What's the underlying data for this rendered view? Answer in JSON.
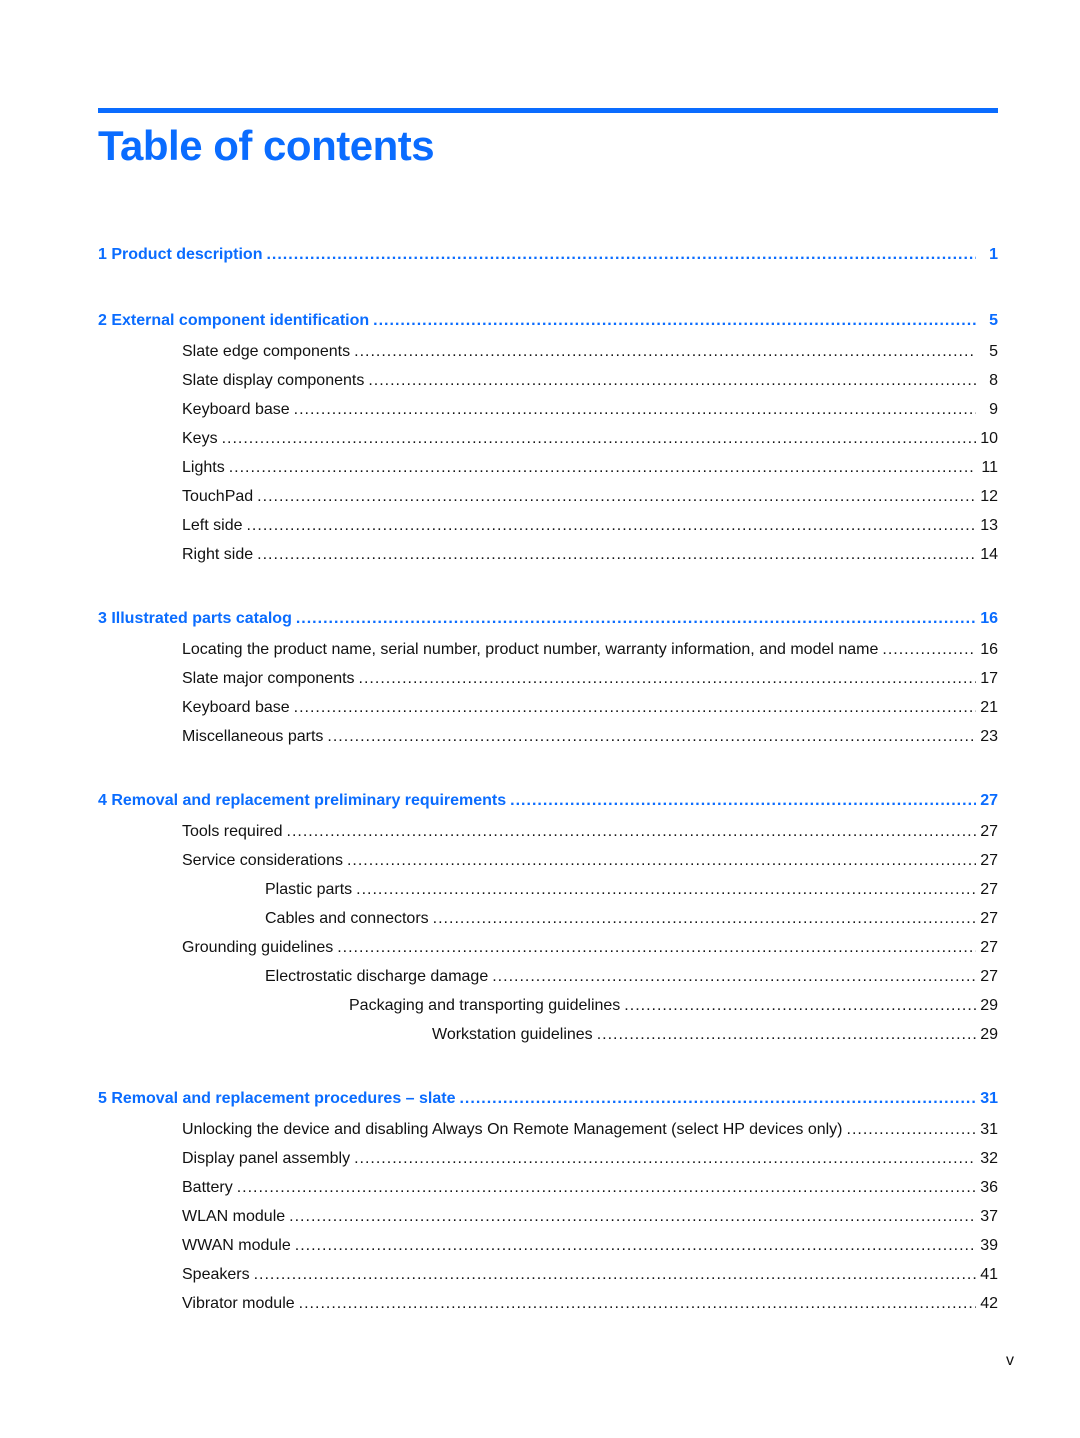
{
  "title": "Table of contents",
  "accent_color": "#0a6cff",
  "entries": [
    {
      "level": 0,
      "text": "1  Product description",
      "page": "1"
    },
    {
      "level": 0,
      "text": "2  External component identification",
      "page": "5"
    },
    {
      "level": 1,
      "text": "Slate edge components",
      "page": "5"
    },
    {
      "level": 1,
      "text": "Slate display components",
      "page": "8"
    },
    {
      "level": 1,
      "text": "Keyboard base",
      "page": "9"
    },
    {
      "level": 1,
      "text": "Keys",
      "page": "10"
    },
    {
      "level": 1,
      "text": "Lights",
      "page": "11"
    },
    {
      "level": 1,
      "text": "TouchPad",
      "page": "12"
    },
    {
      "level": 1,
      "text": "Left side",
      "page": "13"
    },
    {
      "level": 1,
      "text": "Right side",
      "page": "14"
    },
    {
      "level": 0,
      "text": "3  Illustrated parts catalog",
      "page": "16"
    },
    {
      "level": 1,
      "text": "Locating the product name, serial number, product number, warranty information, and model name",
      "page": "16"
    },
    {
      "level": 1,
      "text": "Slate major components",
      "page": "17"
    },
    {
      "level": 1,
      "text": "Keyboard base",
      "page": "21"
    },
    {
      "level": 1,
      "text": "Miscellaneous parts",
      "page": "23"
    },
    {
      "level": 0,
      "text": "4  Removal and replacement preliminary requirements",
      "page": "27"
    },
    {
      "level": 1,
      "text": "Tools required",
      "page": "27"
    },
    {
      "level": 1,
      "text": "Service considerations",
      "page": "27"
    },
    {
      "level": 2,
      "text": "Plastic parts",
      "page": "27"
    },
    {
      "level": 2,
      "text": "Cables and connectors",
      "page": "27"
    },
    {
      "level": 1,
      "text": "Grounding guidelines",
      "page": "27"
    },
    {
      "level": 2,
      "text": "Electrostatic discharge damage",
      "page": "27"
    },
    {
      "level": 3,
      "text": "Packaging and transporting guidelines",
      "page": "29"
    },
    {
      "level": 4,
      "text": "Workstation guidelines",
      "page": "29"
    },
    {
      "level": 0,
      "text": "5  Removal and replacement procedures – slate",
      "page": "31"
    },
    {
      "level": 1,
      "text": "Unlocking the device and disabling Always On Remote Management (select HP devices only)",
      "page": "31"
    },
    {
      "level": 1,
      "text": "Display panel assembly",
      "page": "32"
    },
    {
      "level": 1,
      "text": "Battery",
      "page": "36"
    },
    {
      "level": 1,
      "text": "WLAN module",
      "page": "37"
    },
    {
      "level": 1,
      "text": "WWAN module",
      "page": "39"
    },
    {
      "level": 1,
      "text": "Speakers",
      "page": "41"
    },
    {
      "level": 1,
      "text": "Vibrator module",
      "page": "42"
    }
  ],
  "folio": "v"
}
